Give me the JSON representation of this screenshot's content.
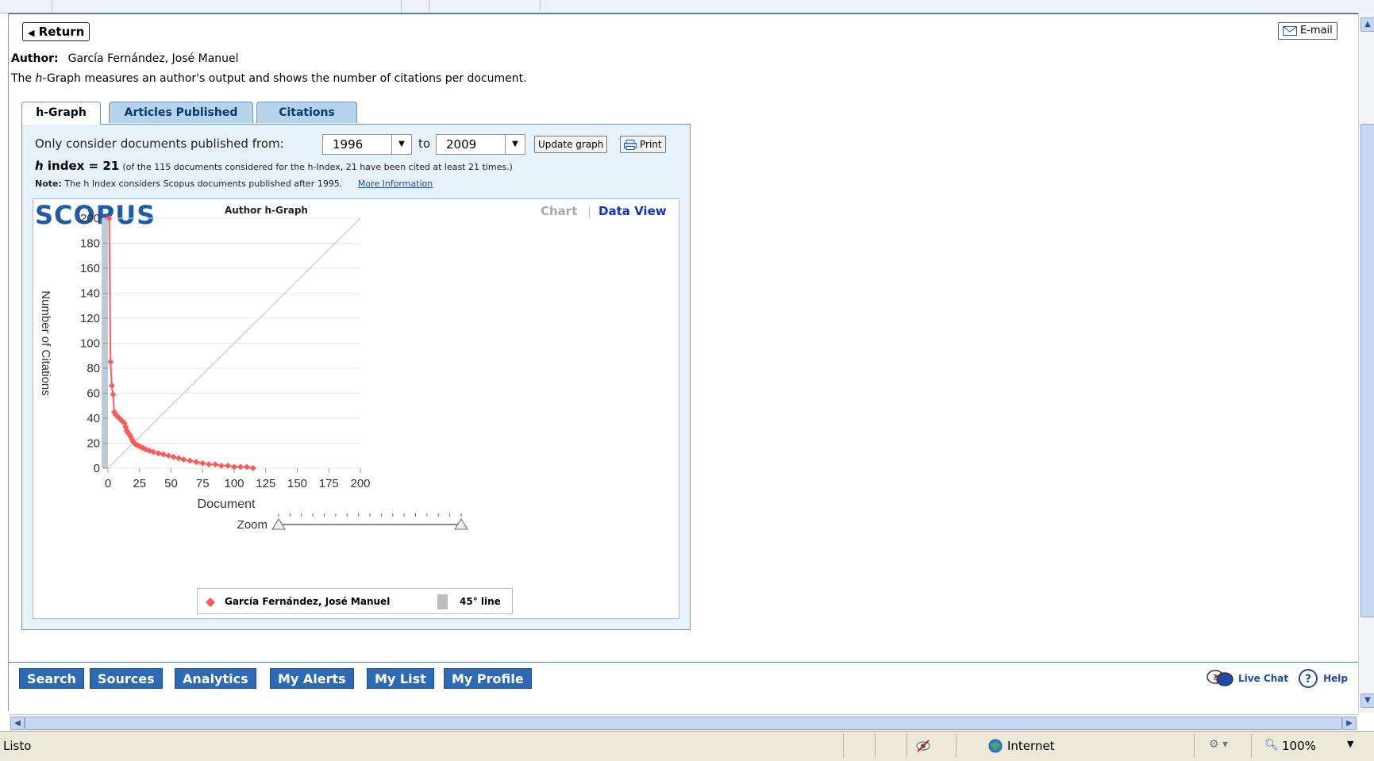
{
  "header": {
    "return_label": "Return",
    "email_label": "E-mail"
  },
  "author": {
    "label": "Author:",
    "name": "García Fernández, José Manuel"
  },
  "description": {
    "prefix": "The ",
    "h": "h",
    "suffix": "-Graph measures an author's output and shows the number of citations per document."
  },
  "tabs": [
    {
      "label": "h-Graph",
      "active": true
    },
    {
      "label": "Articles Published",
      "active": false
    },
    {
      "label": "Citations",
      "active": false
    }
  ],
  "filters": {
    "label": "Only consider documents published from:",
    "from": "1996",
    "to_label": "to",
    "to": "2009",
    "update_label": "Update graph",
    "print_label": "Print"
  },
  "hindex": {
    "h": "h",
    "label": " index = 21",
    "detail": "(of the 115 documents considered for the h-Index, 21 have been cited at least 21 times.)"
  },
  "note": {
    "label": "Note:",
    "text": "The h Index considers Scopus documents published after 1995.",
    "link": "More Information"
  },
  "graph_header": {
    "logo": "SCOPUS",
    "title": "Author h-Graph",
    "view_chart": "Chart",
    "view_sep": "|",
    "view_data": "Data View"
  },
  "chart_data": {
    "type": "scatter",
    "xlabel": "Document",
    "ylabel": "Number of Citations",
    "xlim": [
      0,
      200
    ],
    "ylim": [
      0,
      200
    ],
    "xticks": [
      0,
      25,
      50,
      75,
      100,
      125,
      150,
      175,
      200
    ],
    "yticks": [
      0,
      20,
      40,
      60,
      80,
      100,
      120,
      140,
      160,
      180,
      200
    ],
    "grid": true,
    "series": [
      {
        "name": "García Fernández, José Manuel",
        "color": "#ff5a5a",
        "x": [
          1,
          2,
          3,
          4,
          5,
          6,
          7,
          8,
          9,
          10,
          11,
          12,
          13,
          14,
          15,
          16,
          17,
          18,
          19,
          20,
          22,
          24,
          26,
          28,
          30,
          33,
          36,
          40,
          44,
          48,
          52,
          56,
          60,
          65,
          70,
          75,
          80,
          85,
          90,
          95,
          100,
          105,
          110,
          115
        ],
        "y": [
          200,
          85,
          66,
          59,
          45,
          43,
          42,
          41,
          40,
          39,
          38,
          37,
          36,
          33,
          30,
          28,
          27,
          25,
          23,
          21,
          19,
          18,
          17,
          16,
          15,
          14,
          13,
          12,
          11,
          10,
          9,
          8,
          7,
          6,
          5,
          4,
          3,
          3,
          2,
          2,
          1,
          1,
          1,
          0
        ]
      },
      {
        "name": "45° line",
        "color": "#c0c0c0",
        "x": [
          0,
          200
        ],
        "y": [
          0,
          200
        ]
      }
    ]
  },
  "zoom_label": "Zoom",
  "legend": {
    "series1": "García Fernández, José Manuel",
    "series2": "45° line"
  },
  "nav": {
    "buttons": [
      "Search",
      "Sources",
      "Analytics",
      "My Alerts",
      "My List",
      "My Profile"
    ],
    "live_chat": "Live Chat",
    "help": "Help"
  },
  "statusbar": {
    "status": "Listo",
    "zone": "Internet",
    "zoom": "100%"
  }
}
